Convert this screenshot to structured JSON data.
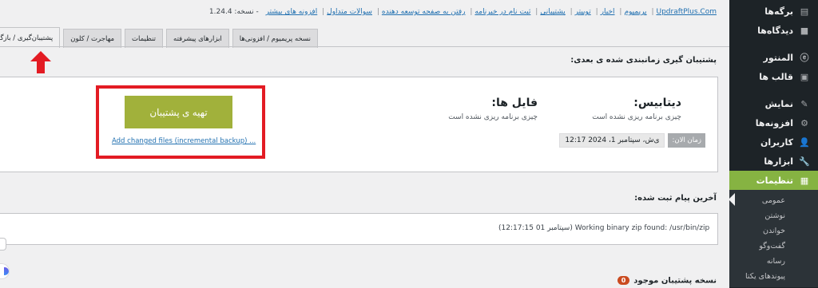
{
  "sidebar": {
    "items": [
      {
        "label": "برگه‌ها",
        "icon": "pages-icon"
      },
      {
        "label": "دیدگاه‌ها",
        "icon": "comments-icon"
      },
      {
        "label": "المنتور",
        "icon": "elementor-icon"
      },
      {
        "label": "قالب ها",
        "icon": "templates-icon"
      },
      {
        "label": "نمایش",
        "icon": "appearance-icon"
      },
      {
        "label": "افزونه‌ها",
        "icon": "plugins-icon"
      },
      {
        "label": "کاربران",
        "icon": "users-icon"
      },
      {
        "label": "ابزارها",
        "icon": "tools-icon"
      },
      {
        "label": "تنظیمات",
        "icon": "settings-icon",
        "active": true
      }
    ],
    "submenu": [
      "عمومی",
      "نوشتن",
      "خواندن",
      "گفت‌وگو",
      "رسانه",
      "پیوندهای یکتا"
    ]
  },
  "header": {
    "links": [
      "UpdraftPlus.Com",
      "پریمیوم",
      "اخبار",
      "توییتر",
      "پشتیبانی",
      "ثبت نام در خبرنامه",
      "رفتن به صفحه توسعه دهنده",
      "سوالات متداول",
      "افزونه های بیشتر"
    ],
    "version": "- نسخه: 1.24.4"
  },
  "tabs": [
    "پشتیبان‌گیری / بازگردانی",
    "مهاجرت / کلون",
    "تنظیمات",
    "ابزارهای پیشرفته",
    "نسخه پریمیوم / افزونی‌ها"
  ],
  "schedule": {
    "title": "پشتیبان گیری زمانبندی شده ی بعدی:",
    "files_title": "فایل ها:",
    "files_status": "چیزی برنامه ریزی نشده است",
    "db_title": "دیتابیس:",
    "db_status": "چیزی برنامه ریزی نشده است",
    "now_label": "زمان الان:",
    "now_value": "ی‌ش، سپتامبر 1، 2024 12:17",
    "backup_button": "تهیه ی پشتیبان",
    "incremental_link": "Add changed files (incremental backup) ..."
  },
  "log": {
    "title": "آخرین پیام ثبت شده:",
    "message": "Working binary zip found: /usr/bin/zip",
    "time": "(سپتامبر 01 12:17:15)"
  },
  "existing": {
    "title": "نسخه پشتیبان موجود",
    "count": "0"
  },
  "colors": {
    "sidebar_bg": "#1d2327",
    "active_menu": "#86b342",
    "backup_button": "#a1b13b",
    "highlight_box": "#e31b23",
    "link": "#2271b1"
  }
}
